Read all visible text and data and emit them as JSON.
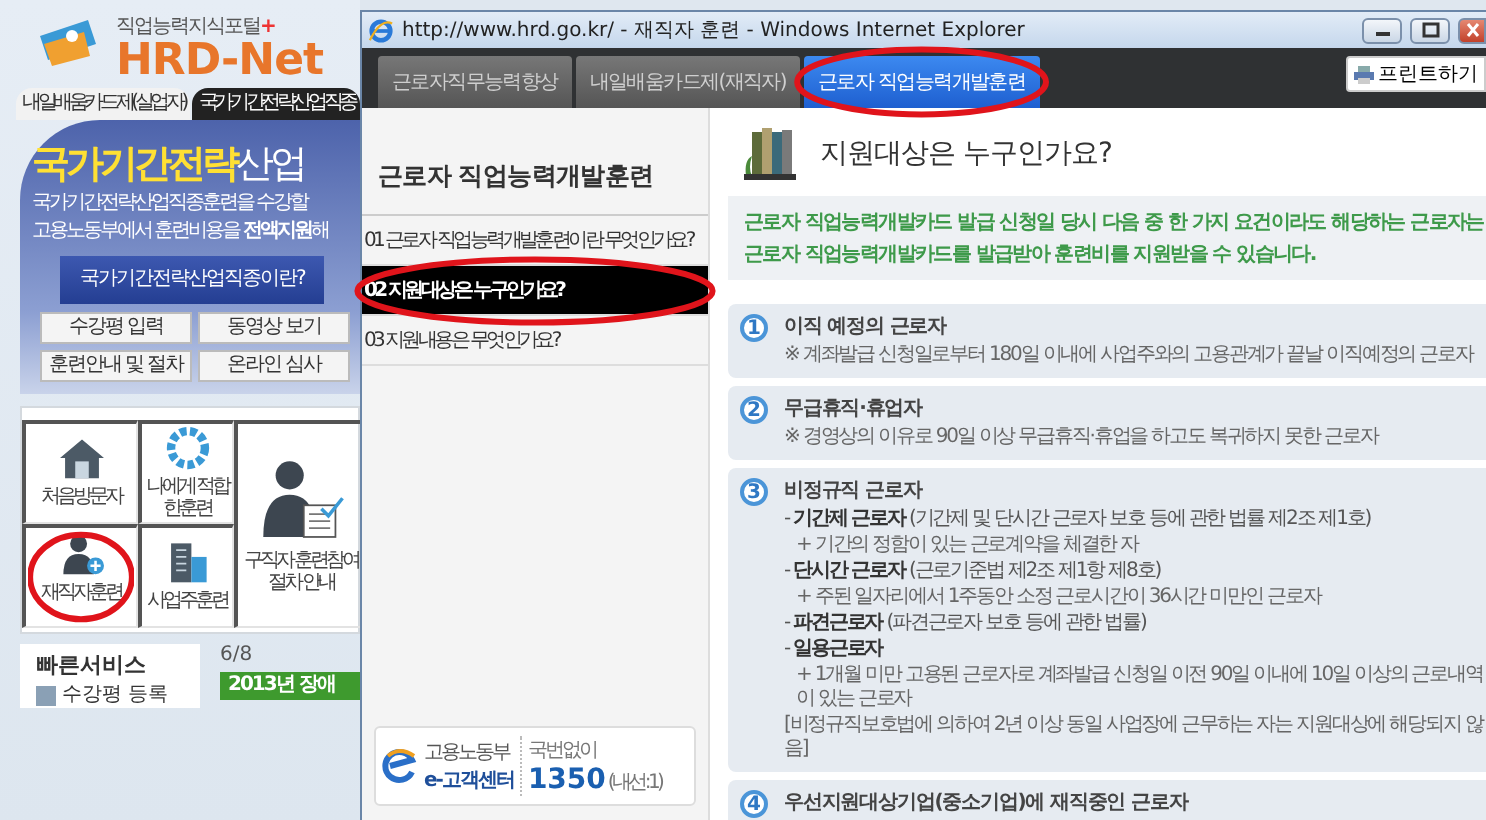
{
  "background_page": {
    "logo": {
      "tagline": "직업능력지식포털",
      "plus": "+",
      "name": "HRD-Net"
    },
    "tabs": [
      {
        "label": "내일배움카드제(실업자)",
        "selected": false
      },
      {
        "label": "국가기간전략산업직종",
        "selected": true
      }
    ],
    "banner": {
      "headline_highlight": "국가기간전략",
      "headline_rest": "산업",
      "lines": [
        "국가기간전략산업직종훈련을 수강할",
        "고용노동부에서 훈련비용을 **전액지원**해"
      ],
      "button": "국가기간전략산업직종이란?",
      "links": [
        "수강평 입력",
        "동영상 보기",
        "훈련안내 및 절차",
        "온라인 심사"
      ]
    },
    "quick_menu": [
      {
        "label": "처음방문자",
        "circled": false
      },
      {
        "label": "나에게 적합한훈련",
        "circled": false
      },
      {
        "label": "구직자 훈련참여 절차 안내",
        "circled": false
      },
      {
        "label": "재직자훈련",
        "circled": true
      },
      {
        "label": "사업주훈련",
        "circled": false
      }
    ],
    "quick_services": {
      "title": "빠른서비스",
      "items": [
        "수강평 등록"
      ]
    },
    "slider": {
      "counter": "6/8",
      "banner_text": "2013년 장애"
    }
  },
  "window": {
    "title": "http://www.hrd.go.kr/ - 재직자 훈련 - Windows Internet Explorer",
    "tabs": [
      {
        "label": "근로자직무능력향상",
        "selected": false,
        "circled": false
      },
      {
        "label": "내일배움카드제(재직자)",
        "selected": false,
        "circled": false
      },
      {
        "label": "근로자 직업능력개발훈련",
        "selected": true,
        "circled": true
      }
    ],
    "print_button": "프린트하기",
    "sidebar": {
      "title": "근로자 직업능력개발훈련",
      "items": [
        {
          "label": "01 근로자 직업능력개발훈련이란 무엇인가요?",
          "selected": false,
          "circled": false
        },
        {
          "label": "02 지원대상은 누구인가요?",
          "selected": true,
          "circled": true
        },
        {
          "label": "03 지원내용은 무엇인가요?",
          "selected": false,
          "circled": false
        }
      ],
      "help_center": {
        "ministry": "고용노동부",
        "name": "e-고객센터",
        "prefix": "국번없이",
        "number": "1350",
        "ext": "(내선:1)"
      }
    },
    "content": {
      "heading": "지원대상은 누구인가요?",
      "intro": [
        "근로자 직업능력개발카드 발급 신청일 당시 다음 중 한 가지 요건이라도 해당하는 근로자는",
        "근로자 직업능력개발카드를 발급받아 훈련비를 지원받을 수 있습니다."
      ],
      "items": [
        {
          "number": "1",
          "title": "이직 예정의 근로자",
          "lines": [
            {
              "kind": "note",
              "text": "※ 계좌발급 신청일로부터 180일 이내에 사업주와의 고용관계가 끝날 이직예정의 근로자"
            }
          ]
        },
        {
          "number": "2",
          "title": "무급휴직·휴업자",
          "lines": [
            {
              "kind": "note",
              "text": "※ 경영상의 이유로 90일 이상 무급휴직·휴업을 하고도 복귀하지 못한 근로자"
            }
          ]
        },
        {
          "number": "3",
          "title": "비정규직 근로자",
          "lines": [
            {
              "kind": "sub",
              "text": "- **기간제 근로자** (기간제 및 단시간 근로자 보호 등에 관한 법률 제2조 제1호)"
            },
            {
              "kind": "detail",
              "text": "+ 기간의 정함이 있는 근로계약을 체결한 자"
            },
            {
              "kind": "sub",
              "text": "- **단시간 근로자** (근로기준법 제2조 제1항 제8호)"
            },
            {
              "kind": "detail",
              "text": "+ 주된 일자리에서 1주동안 소정 근로시간이 36시간 미만인 근로자"
            },
            {
              "kind": "sub",
              "text": "- **파견근로자** (파견근로자 보호 등에 관한 법률)"
            },
            {
              "kind": "sub",
              "text": "- **일용근로자**"
            },
            {
              "kind": "detail",
              "text": "+ 1개월 미만 고용된 근로자로 계좌발급 신청일 이전 90일 이내에 10일 이상의 근로내역이 있는 근로자"
            },
            {
              "kind": "note",
              "text": "[비정규직보호법에 의하여 2년 이상 동일 사업장에 근무하는 자는 지원대상에 해당되지 않음]"
            }
          ]
        },
        {
          "number": "4",
          "title": "우선지원대상기업(중소기업)에 재직중인 근로자"
        }
      ]
    }
  }
}
